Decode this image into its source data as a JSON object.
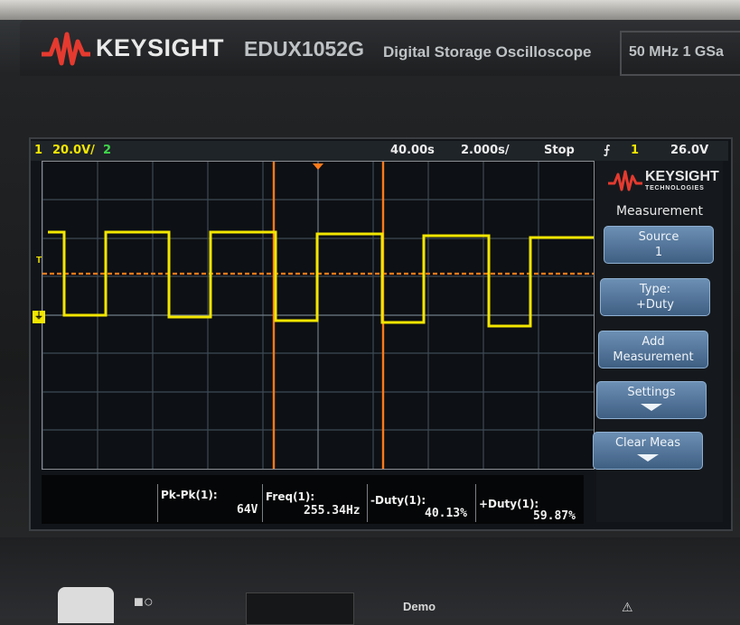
{
  "device": {
    "brand": "KEYSIGHT",
    "model": "EDUX1052G",
    "description": "Digital Storage Oscilloscope",
    "spec": "50 MHz  1 GSa"
  },
  "status": {
    "ch1_number": "1",
    "ch1_scale": "20.0V/",
    "ch2_number": "2",
    "time_offset": "40.00s",
    "time_scale": "2.000s/",
    "run_state": "Stop",
    "trigger_channel": "1",
    "trigger_level": "26.0V"
  },
  "softkeys": {
    "brand": "KEYSIGHT",
    "brand_sub": "TECHNOLOGIES",
    "menu_title": "Measurement",
    "source_label": "Source",
    "source_value": "1",
    "type_label": "Type:",
    "type_value": "+Duty",
    "add_label_1": "Add",
    "add_label_2": "Measurement",
    "settings_label": "Settings",
    "clear_label": "Clear Meas"
  },
  "measurements": [
    {
      "name": "Pk-Pk(1):",
      "value": "64V"
    },
    {
      "name": "Freq(1):",
      "value": "255.34Hz"
    },
    {
      "name": "-Duty(1):",
      "value": "40.13%"
    },
    {
      "name": "+Duty(1):",
      "value": "59.87%"
    }
  ],
  "front_panel": {
    "demo_label": "Demo"
  },
  "colors": {
    "ch1": "#f2e600",
    "trigger_cursor": "#ff7a1a",
    "softkey_blue": "#4f7196"
  },
  "icons": [
    "keysight-wave-logo",
    "trigger-icon",
    "down-arrow-icon",
    "power-icon",
    "warning-icon"
  ]
}
